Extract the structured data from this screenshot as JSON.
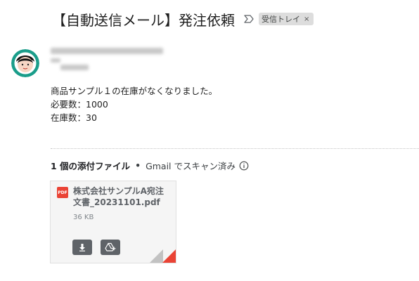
{
  "email": {
    "subject": "【自動送信メール】発注依頼",
    "label": "受信トレイ",
    "label_remove": "×"
  },
  "body": {
    "line1": "商品サンプル１の在庫がなくなりました。",
    "line2": "必要数：1000",
    "line3": "在庫数：30"
  },
  "attachments": {
    "count_text": "1 個の添付ファイル",
    "separator": "•",
    "scan_text": "Gmail でスキャン済み",
    "file": {
      "type_badge": "PDF",
      "name": "株式会社サンプルA宛注文書_20231101.pdf",
      "size": "36 KB"
    }
  },
  "icons": {
    "important": "important-marker-icon",
    "info": "info-icon",
    "download": "download-icon",
    "drive": "add-to-drive-icon"
  }
}
